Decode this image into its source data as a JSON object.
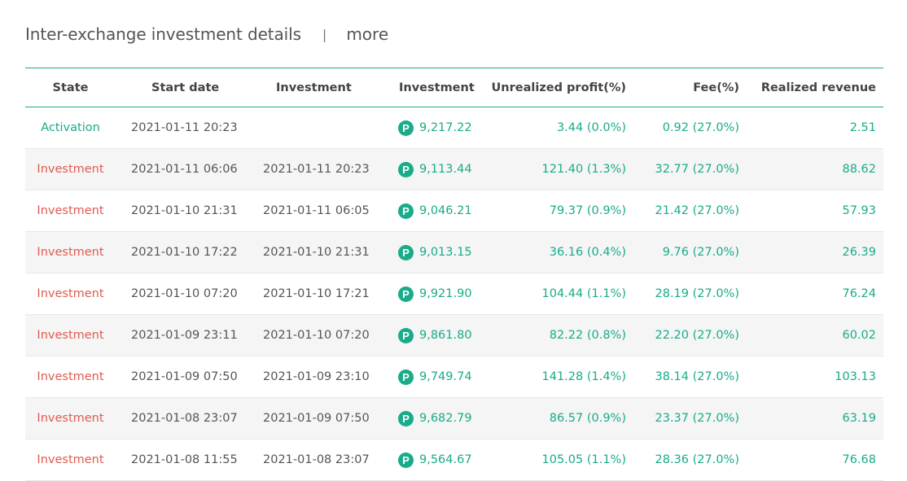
{
  "header": {
    "title": "Inter-exchange investment details",
    "separator": "|",
    "more": "more"
  },
  "table": {
    "columns": [
      "State",
      "Start date",
      "Investment",
      "Investment",
      "Unrealized profit(%)",
      "Fee(%)",
      "Realized revenue"
    ],
    "coin_icon": "P",
    "rows": [
      {
        "state": "Activation",
        "start": "2021-01-11 20:23",
        "end": "",
        "amount": "9,217.22",
        "unrealized": "3.44 (0.0%)",
        "fee": "0.92 (27.0%)",
        "realized": "2.51"
      },
      {
        "state": "Investment",
        "start": "2021-01-11 06:06",
        "end": "2021-01-11 20:23",
        "amount": "9,113.44",
        "unrealized": "121.40 (1.3%)",
        "fee": "32.77 (27.0%)",
        "realized": "88.62"
      },
      {
        "state": "Investment",
        "start": "2021-01-10 21:31",
        "end": "2021-01-11 06:05",
        "amount": "9,046.21",
        "unrealized": "79.37 (0.9%)",
        "fee": "21.42 (27.0%)",
        "realized": "57.93"
      },
      {
        "state": "Investment",
        "start": "2021-01-10 17:22",
        "end": "2021-01-10 21:31",
        "amount": "9,013.15",
        "unrealized": "36.16 (0.4%)",
        "fee": "9.76 (27.0%)",
        "realized": "26.39"
      },
      {
        "state": "Investment",
        "start": "2021-01-10 07:20",
        "end": "2021-01-10 17:21",
        "amount": "9,921.90",
        "unrealized": "104.44 (1.1%)",
        "fee": "28.19 (27.0%)",
        "realized": "76.24"
      },
      {
        "state": "Investment",
        "start": "2021-01-09 23:11",
        "end": "2021-01-10 07:20",
        "amount": "9,861.80",
        "unrealized": "82.22 (0.8%)",
        "fee": "22.20 (27.0%)",
        "realized": "60.02"
      },
      {
        "state": "Investment",
        "start": "2021-01-09 07:50",
        "end": "2021-01-09 23:10",
        "amount": "9,749.74",
        "unrealized": "141.28 (1.4%)",
        "fee": "38.14 (27.0%)",
        "realized": "103.13"
      },
      {
        "state": "Investment",
        "start": "2021-01-08 23:07",
        "end": "2021-01-09 07:50",
        "amount": "9,682.79",
        "unrealized": "86.57 (0.9%)",
        "fee": "23.37 (27.0%)",
        "realized": "63.19"
      },
      {
        "state": "Investment",
        "start": "2021-01-08 11:55",
        "end": "2021-01-08 23:07",
        "amount": "9,564.67",
        "unrealized": "105.05 (1.1%)",
        "fee": "28.36 (27.0%)",
        "realized": "76.68"
      }
    ]
  },
  "colors": {
    "accent": "#1aab8a",
    "state_investment": "#e05a4f",
    "state_activation": "#1aab8a"
  }
}
